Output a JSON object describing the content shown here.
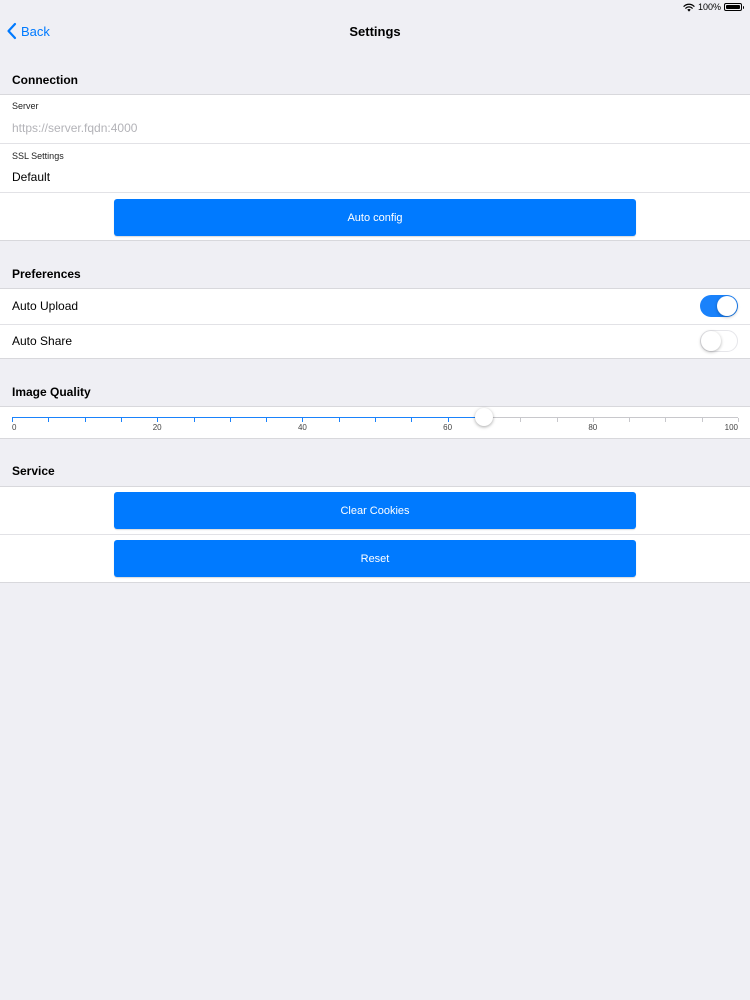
{
  "status_bar": {
    "battery": "100%"
  },
  "nav": {
    "back_label": "Back",
    "title": "Settings"
  },
  "connection": {
    "header": "Connection",
    "server_label": "Server",
    "server_value": "",
    "server_placeholder": "https://server.fqdn:4000",
    "ssl_label": "SSL Settings",
    "ssl_value": "Default",
    "auto_config_label": "Auto config"
  },
  "preferences": {
    "header": "Preferences",
    "auto_upload_label": "Auto Upload",
    "auto_upload_on": true,
    "auto_share_label": "Auto Share",
    "auto_share_on": false
  },
  "image_quality": {
    "header": "Image Quality",
    "min": 0,
    "max": 100,
    "value": 65,
    "tick_step": 5,
    "tick_labels": [
      "0",
      "20",
      "40",
      "60",
      "80",
      "100"
    ]
  },
  "service": {
    "header": "Service",
    "clear_cookies_label": "Clear Cookies",
    "reset_label": "Reset"
  },
  "colors": {
    "accent": "#007aff",
    "background": "#efeff4"
  },
  "icons": {
    "wifi": "wifi-icon",
    "battery": "battery-icon",
    "back": "chevron-left-icon"
  }
}
